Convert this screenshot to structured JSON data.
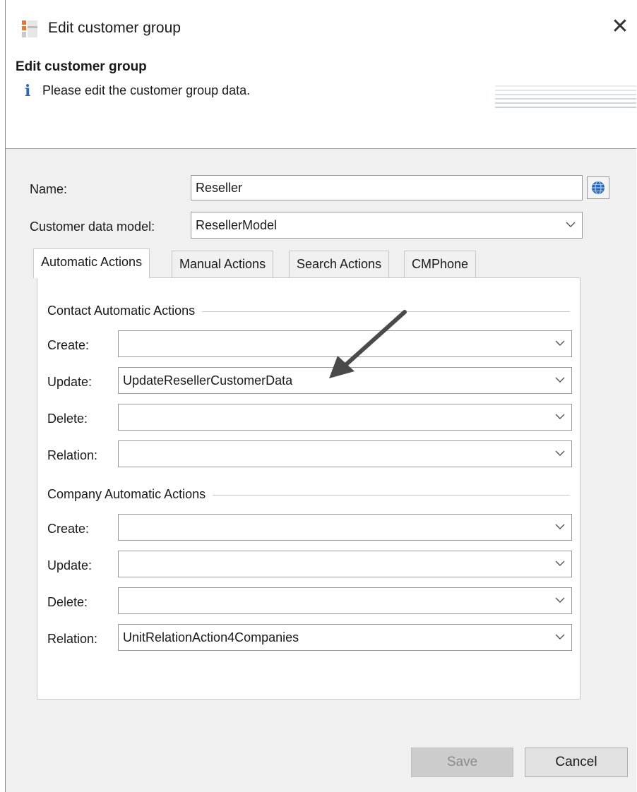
{
  "window": {
    "title": "Edit customer group",
    "close_symbol": "✕"
  },
  "header": {
    "title": "Edit customer group",
    "info_symbol": "i",
    "message": "Please edit the customer group data."
  },
  "form": {
    "name_label": "Name:",
    "name_value": "Reseller",
    "model_label": "Customer data model:",
    "model_value": "ResellerModel"
  },
  "tabs": [
    {
      "label": "Automatic Actions",
      "active": true
    },
    {
      "label": "Manual Actions",
      "active": false
    },
    {
      "label": "Search Actions",
      "active": false
    },
    {
      "label": "CMPhone",
      "active": false
    }
  ],
  "contact_group": {
    "title": "Contact Automatic Actions",
    "rows": [
      {
        "label": "Create:",
        "value": ""
      },
      {
        "label": "Update:",
        "value": "UpdateResellerCustomerData"
      },
      {
        "label": "Delete:",
        "value": ""
      },
      {
        "label": "Relation:",
        "value": ""
      }
    ]
  },
  "company_group": {
    "title": "Company Automatic Actions",
    "rows": [
      {
        "label": "Create:",
        "value": ""
      },
      {
        "label": "Update:",
        "value": ""
      },
      {
        "label": "Delete:",
        "value": ""
      },
      {
        "label": "Relation:",
        "value": "UnitRelationAction4Companies"
      }
    ]
  },
  "buttons": {
    "save": "Save",
    "cancel": "Cancel"
  },
  "colors": {
    "accent_blue": "#2b68b8",
    "arrow": "#4a4a4a",
    "disabled_bg": "#cccccc"
  },
  "icons": {
    "app": "app-icon",
    "close": "close-icon",
    "info": "info-icon",
    "globe": "globe-icon",
    "chevron": "chevron-down-icon"
  }
}
